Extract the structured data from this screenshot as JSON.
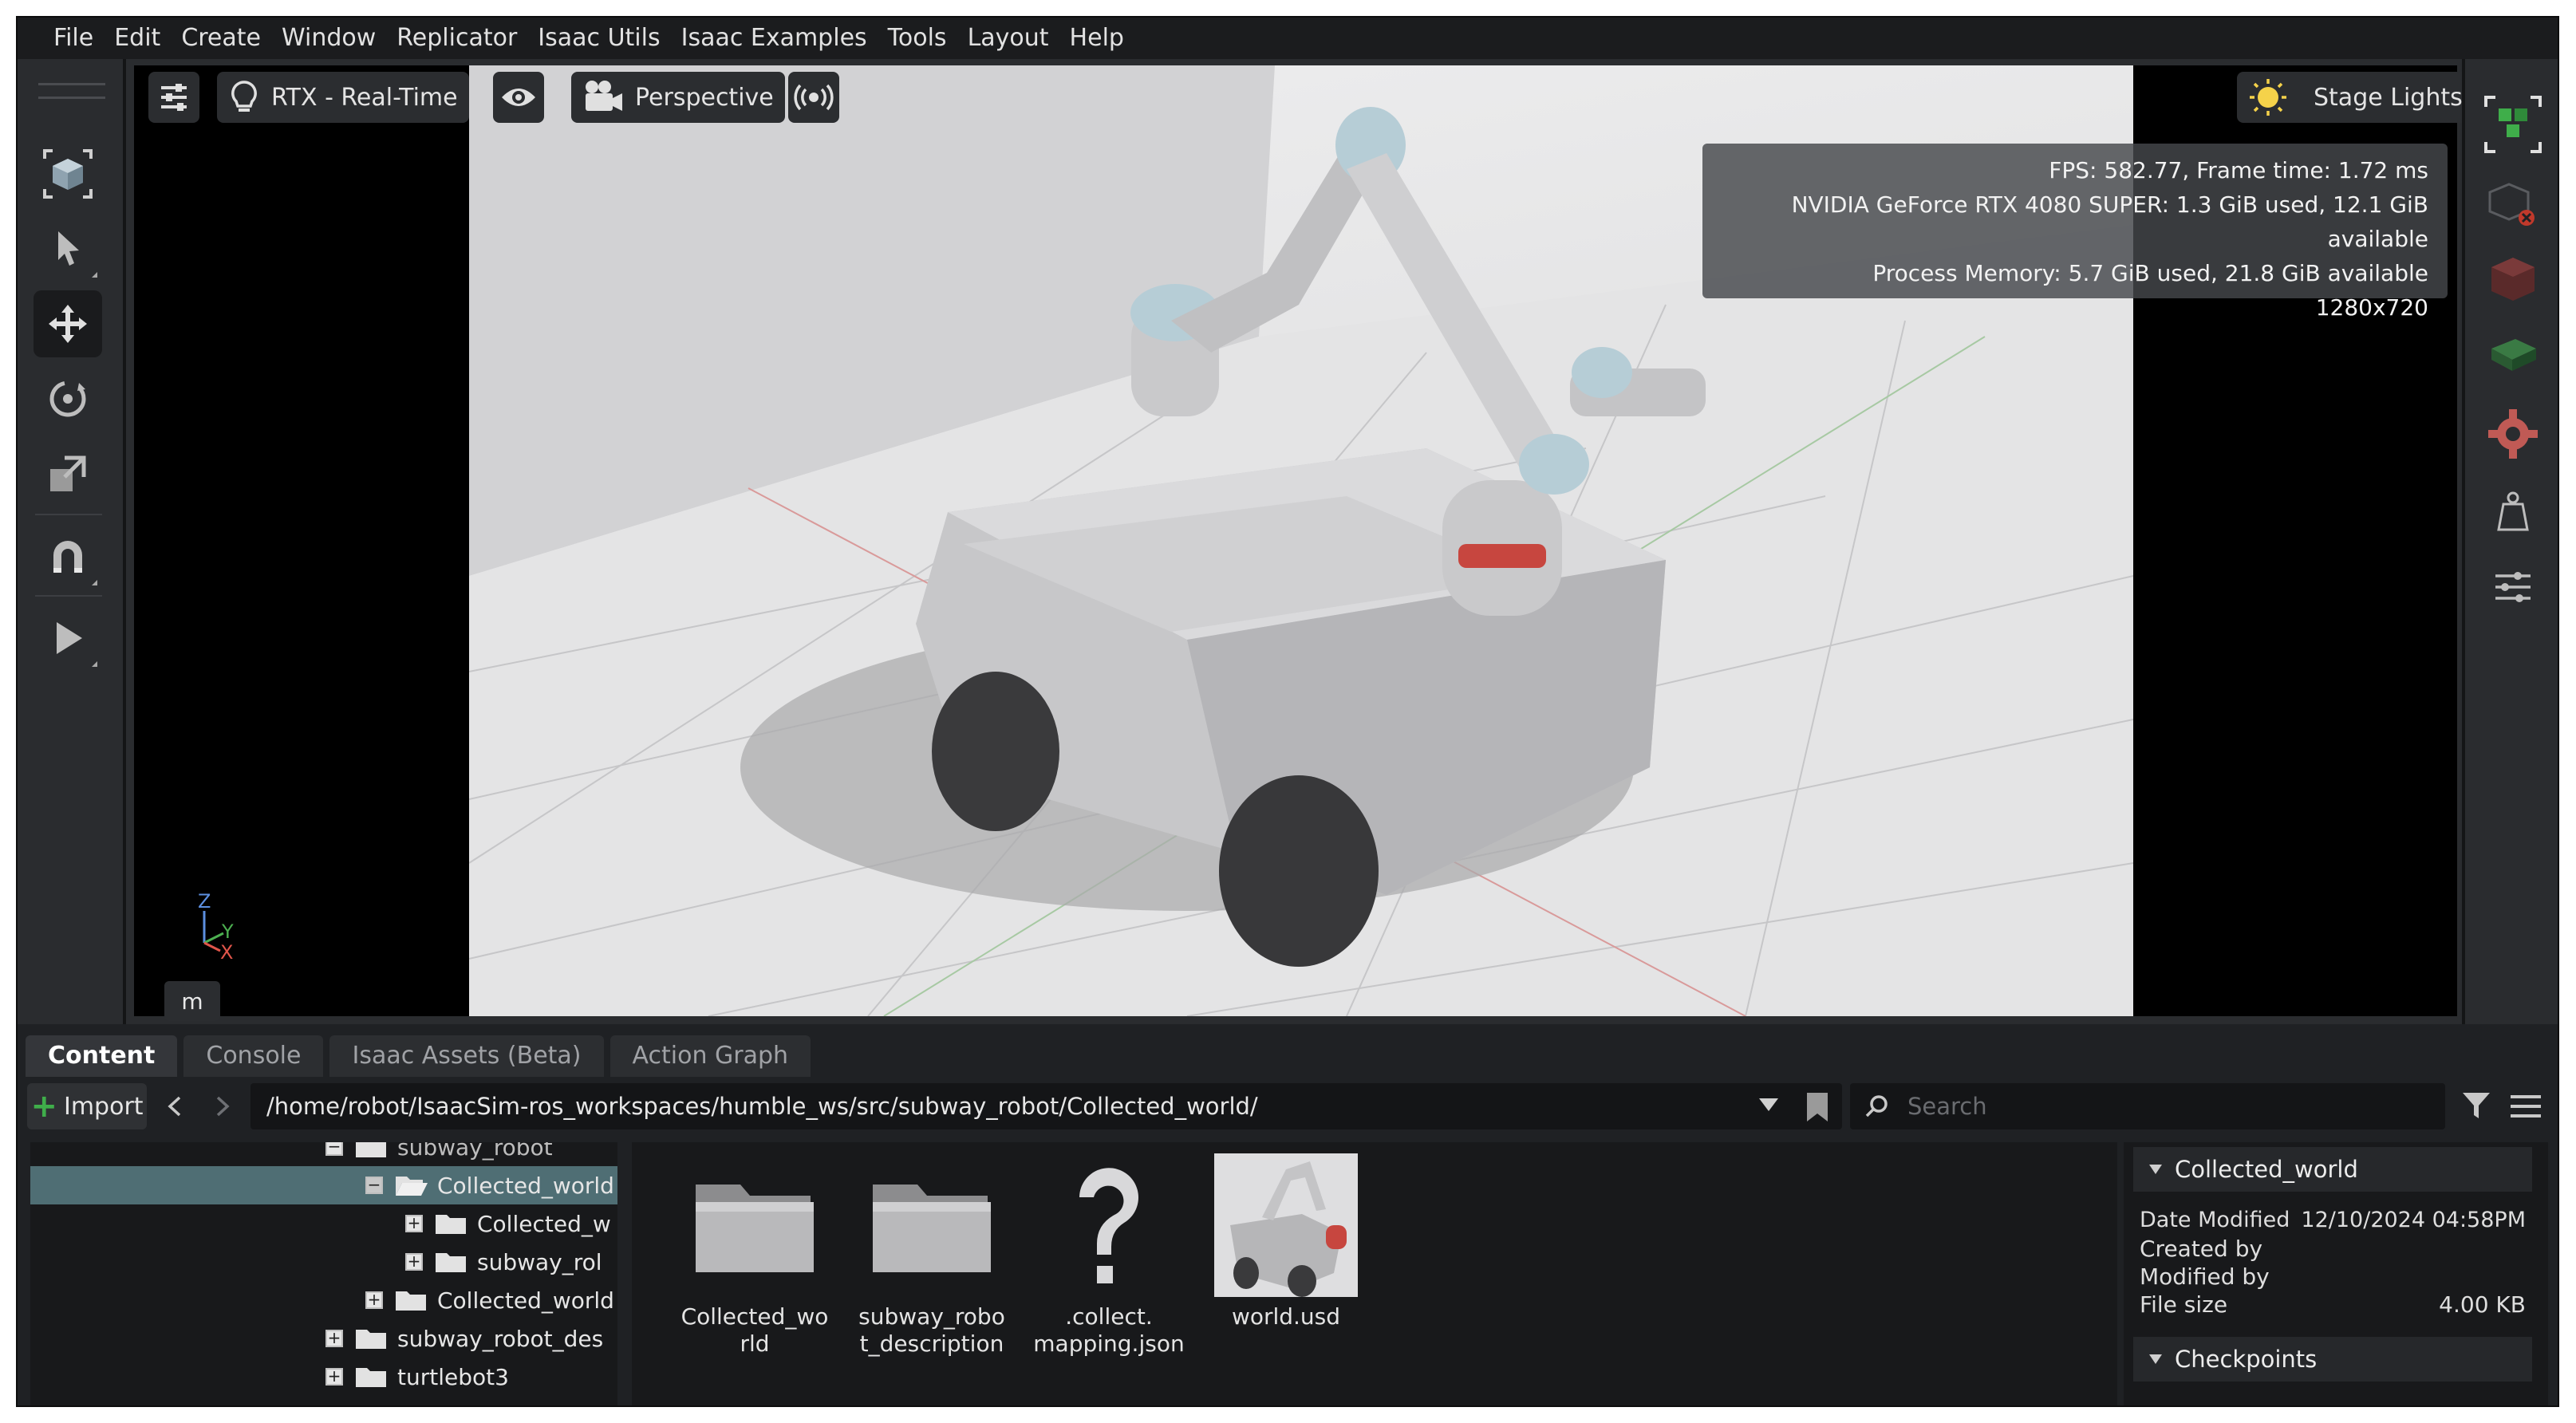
{
  "menu": [
    "File",
    "Edit",
    "Create",
    "Window",
    "Replicator",
    "Isaac Utils",
    "Isaac Examples",
    "Tools",
    "Layout",
    "Help"
  ],
  "viewport": {
    "render_mode": "RTX - Real-Time",
    "camera": "Perspective",
    "stage_lights": "Stage Lights",
    "stats": {
      "fps": "FPS: 582.77, Frame time: 1.72 ms",
      "gpu": "NVIDIA GeForce RTX 4080 SUPER: 1.3 GiB used, 12.1 GiB available",
      "mem": "Process Memory: 5.7 GiB used, 21.8 GiB available",
      "res": "1280x720"
    },
    "axis": {
      "z": "Z",
      "y": "Y",
      "x": "X"
    },
    "unit": "m"
  },
  "tabs": [
    "Content",
    "Console",
    "Isaac Assets (Beta)",
    "Action Graph"
  ],
  "content": {
    "import_label": "Import",
    "path": "/home/robot/IsaacSim-ros_workspaces/humble_ws/src/subway_robot/Collected_world/",
    "search_placeholder": "Search",
    "tree": [
      {
        "label": "subway_robot",
        "expander": "−"
      },
      {
        "label": "Collected_world",
        "expander": "−"
      },
      {
        "label": "Collected_w",
        "expander": "+"
      },
      {
        "label": "subway_rol",
        "expander": "+"
      },
      {
        "label": "Collected_world",
        "expander": "+"
      },
      {
        "label": "subway_robot_des",
        "expander": "+"
      },
      {
        "label": "turtlebot3",
        "expander": "+"
      }
    ],
    "files": [
      {
        "line1": "Collected_wo",
        "line2": "rld"
      },
      {
        "line1": "subway_robo",
        "line2": "t_description"
      },
      {
        "line1": ".collect.",
        "line2": "mapping.json"
      },
      {
        "line1": "world.usd",
        "line2": ""
      }
    ],
    "details": {
      "title": "Collected_world",
      "date_modified_label": "Date Modified",
      "date_modified": "12/10/2024 04:58PM",
      "created_by_label": "Created by",
      "modified_by_label": "Modified by",
      "file_size_label": "File size",
      "file_size": "4.00 KB",
      "checkpoints": "Checkpoints"
    }
  },
  "colors": {
    "selection": "#4f6e74",
    "accent_green": "#3fae4a",
    "lights": "#f5d24a"
  }
}
